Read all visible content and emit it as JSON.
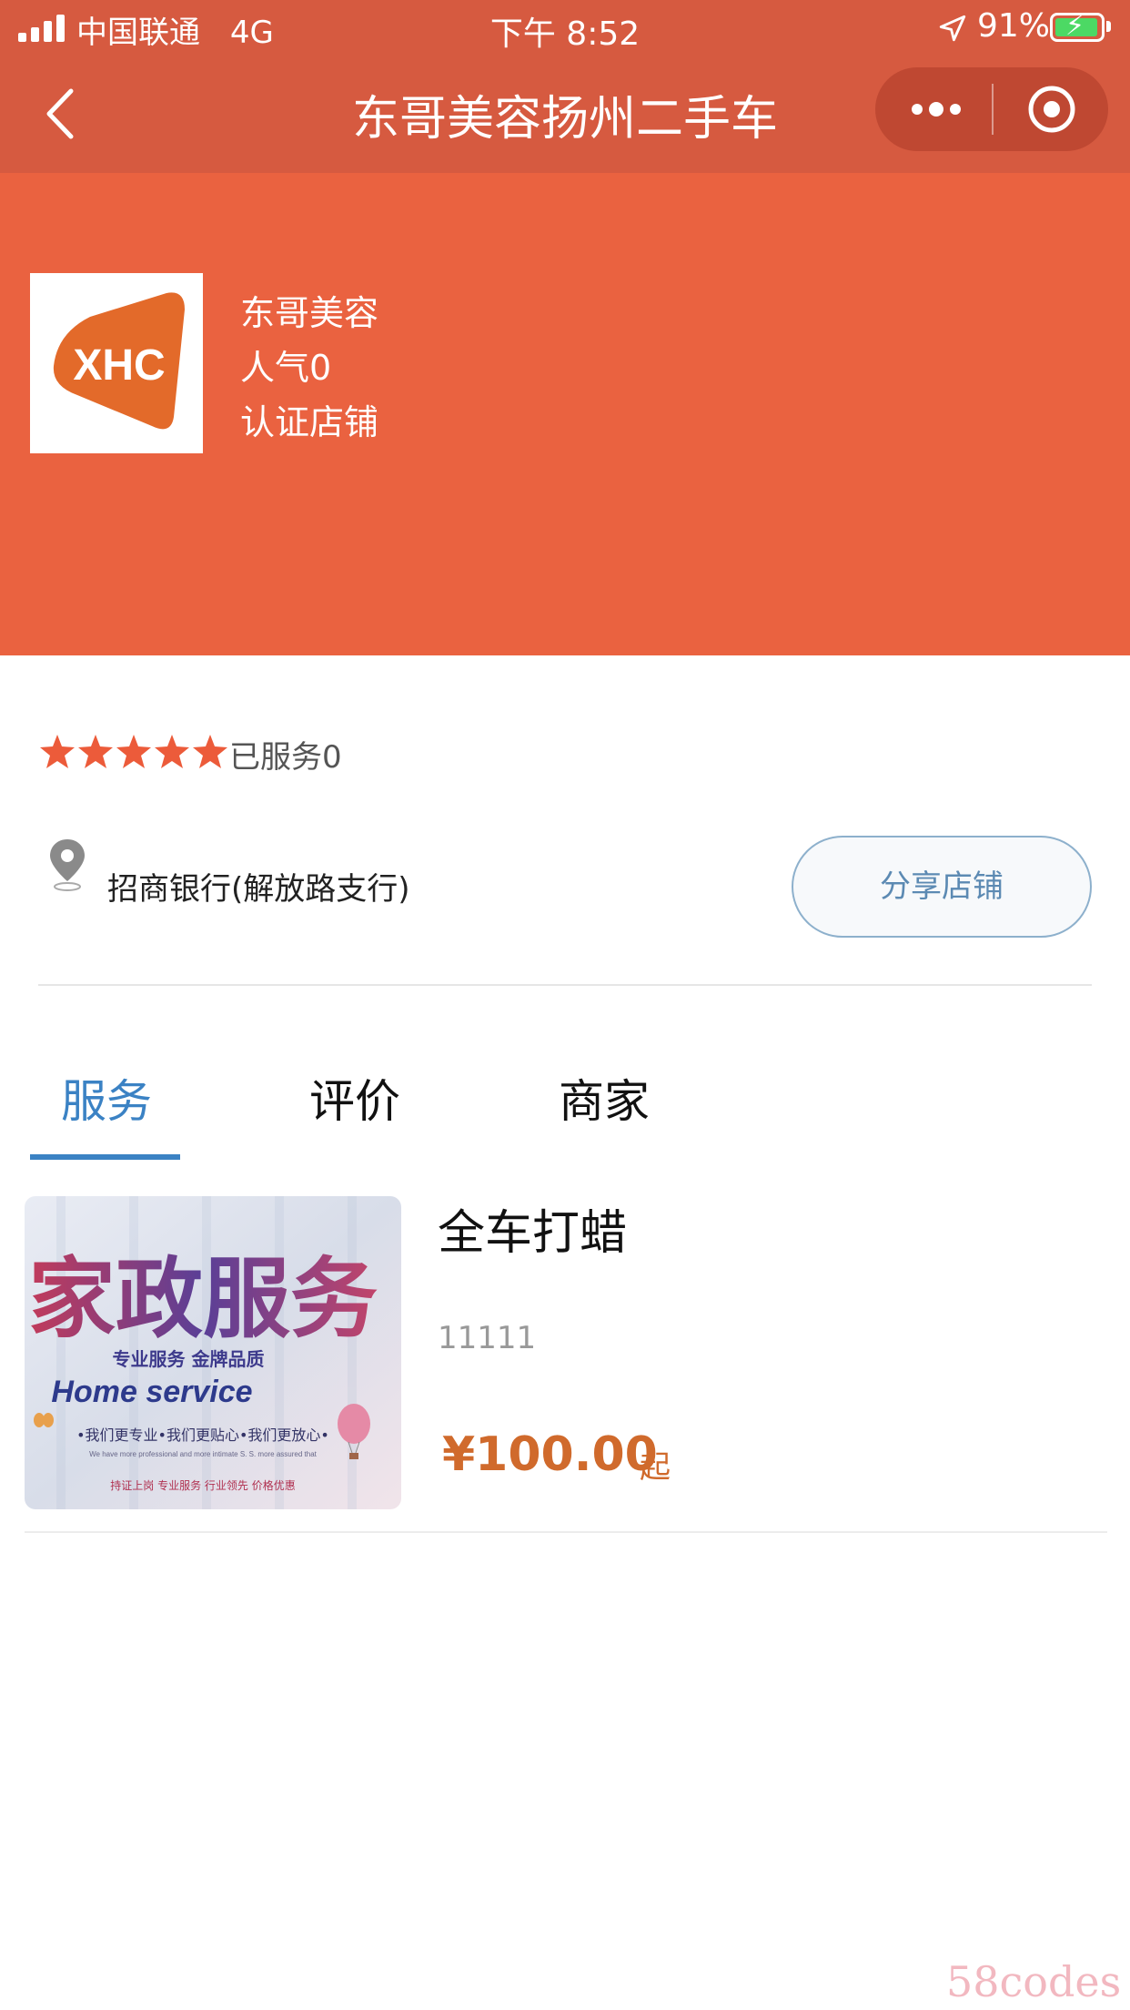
{
  "status_bar": {
    "carrier": "中国联通",
    "network": "4G",
    "time": "下午 8:52",
    "battery": "91%"
  },
  "nav": {
    "title": "东哥美容扬州二手车"
  },
  "store": {
    "logo_text": "XHC",
    "name": "东哥美容",
    "popularity": "人气0",
    "certified": "认证店铺"
  },
  "rating": {
    "stars": 5,
    "served": "已服务0"
  },
  "address": {
    "text": "招商银行(解放路支行)",
    "share_label": "分享店铺"
  },
  "tabs": [
    {
      "label": "服务",
      "active": true
    },
    {
      "label": "评价",
      "active": false
    },
    {
      "label": "商家",
      "active": false
    }
  ],
  "items": [
    {
      "title": "全车打蜡",
      "desc": "11111",
      "price": "¥100.00",
      "price_suffix": "起",
      "image_texts": {
        "headline": "家政服务",
        "sub": "专业服务 金牌品质",
        "english": "Home service",
        "slogan": "•我们更专业•我们更贴心•我们更放心•",
        "small_en": "We have more professional and more intimate S. S. more assured that",
        "footer": "持证上岗 专业服务 行业领先 价格优惠"
      }
    }
  ],
  "watermark": "58codes",
  "colors": {
    "nav_bg": "#d65a40",
    "header_bg": "#ea6240",
    "accent_blue": "#3b82c4",
    "price": "#d06a2c",
    "star": "#ec5b3a"
  }
}
